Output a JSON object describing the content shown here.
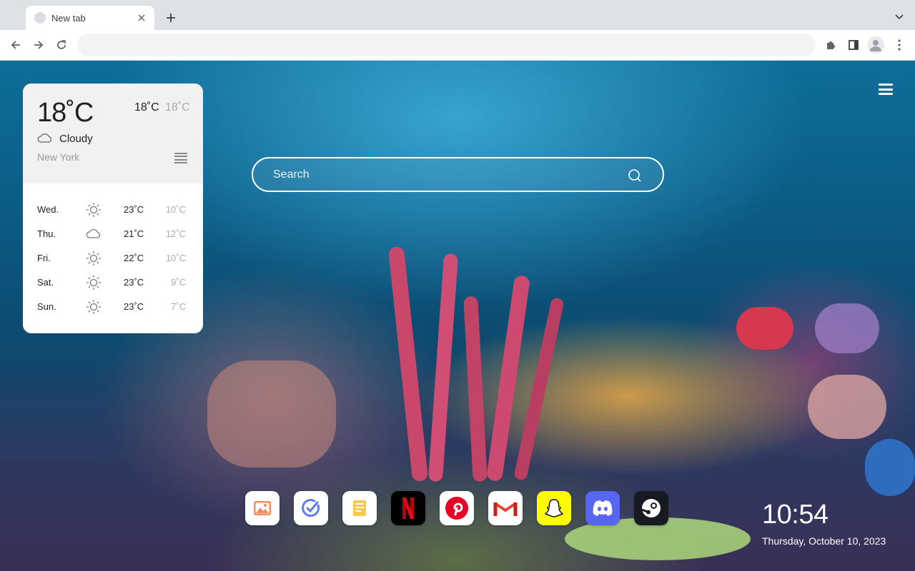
{
  "browser": {
    "tab_title": "New tab",
    "address_value": ""
  },
  "weather": {
    "current_temp": "18˚C",
    "high": "18˚C",
    "low": "18˚C",
    "condition": "Cloudy",
    "condition_icon": "cloud-icon",
    "city": "New York",
    "forecast": [
      {
        "day": "Wed.",
        "icon": "sun-icon",
        "high": "23˚C",
        "low": "10˚C"
      },
      {
        "day": "Thu.",
        "icon": "cloud-icon",
        "high": "21˚C",
        "low": "12˚C"
      },
      {
        "day": "Fri.",
        "icon": "sun-icon",
        "high": "22˚C",
        "low": "10˚C"
      },
      {
        "day": "Sat.",
        "icon": "sun-icon",
        "high": "23˚C",
        "low": "9˚C"
      },
      {
        "day": "Sun.",
        "icon": "sun-icon",
        "high": "23˚C",
        "low": "7˚C"
      }
    ]
  },
  "search": {
    "placeholder": "Search"
  },
  "dock": {
    "apps": [
      {
        "name": "gallery",
        "icon": "image-icon",
        "color": "#ffffff"
      },
      {
        "name": "todo",
        "icon": "check-circle-icon",
        "color": "#ffffff"
      },
      {
        "name": "notes",
        "icon": "note-icon",
        "color": "#ffffff"
      },
      {
        "name": "netflix",
        "icon": "netflix-icon",
        "color": "#000000"
      },
      {
        "name": "pinterest",
        "icon": "pinterest-icon",
        "color": "#ffffff"
      },
      {
        "name": "gmail",
        "icon": "gmail-icon",
        "color": "#ffffff"
      },
      {
        "name": "snapchat",
        "icon": "snapchat-icon",
        "color": "#fffc00"
      },
      {
        "name": "discord",
        "icon": "discord-icon",
        "color": "#5865f2"
      },
      {
        "name": "steam",
        "icon": "steam-icon",
        "color": "#171a21"
      }
    ]
  },
  "clock": {
    "time": "10:54",
    "date": "Thursday, October 10, 2023"
  }
}
